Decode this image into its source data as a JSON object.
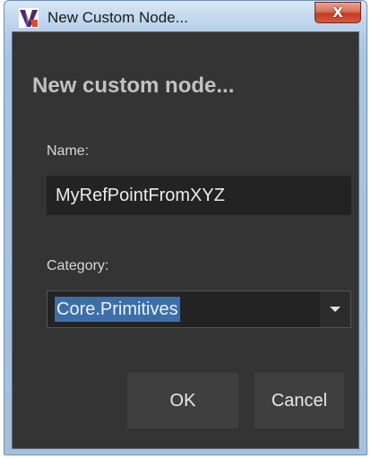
{
  "window": {
    "title": "New Custom Node...",
    "close_glyph": "X"
  },
  "dialog": {
    "heading": "New custom node...",
    "name_label": "Name:",
    "name_value": "MyRefPointFromXYZ",
    "category_label": "Category:",
    "category_value": "Core.Primitives",
    "ok_label": "OK",
    "cancel_label": "Cancel"
  },
  "icons": {
    "app": "dynamo-app-icon",
    "close": "close-icon",
    "dropdown": "chevron-down-icon"
  },
  "colors": {
    "dialog_background": "#343434",
    "input_background": "#232323",
    "selection_highlight": "#3b6fa8",
    "button_background": "#3f3f3f",
    "close_button": "#c23b22"
  }
}
